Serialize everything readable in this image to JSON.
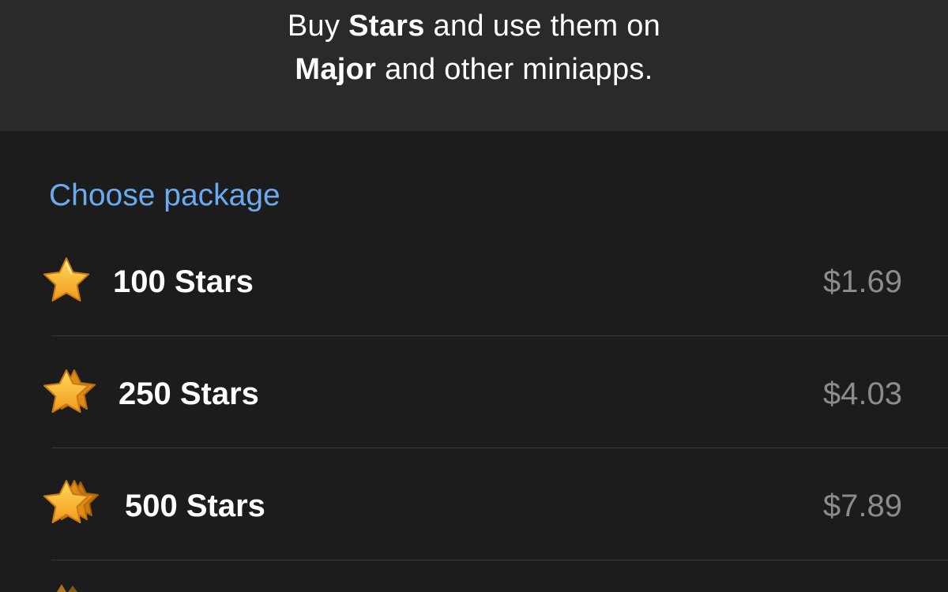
{
  "header": {
    "line1_prefix": "Buy",
    "line1_bold": "Stars",
    "line1_suffix": "and use them on",
    "line2_bold": "Major",
    "line2_suffix": "and other miniapps."
  },
  "section_title": "Choose package",
  "packages": [
    {
      "label": "100 Stars",
      "price": "$1.69",
      "icon": "star-icon"
    },
    {
      "label": "250 Stars",
      "price": "$4.03",
      "icon": "stars-double-icon"
    },
    {
      "label": "500 Stars",
      "price": "$7.89",
      "icon": "stars-triple-icon"
    }
  ],
  "colors": {
    "header_bg": "#2a2a2b",
    "page_bg": "#1c1c1d",
    "accent": "#6aaaf0",
    "price": "#8c8c8e",
    "star": "#f7b731"
  }
}
